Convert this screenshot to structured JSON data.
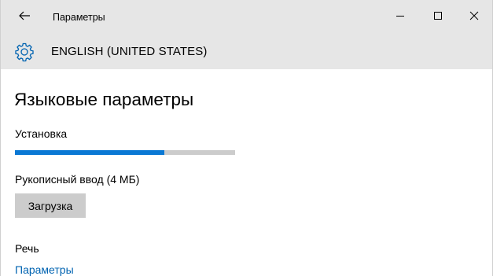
{
  "window": {
    "title": "Параметры",
    "back_icon": "back-arrow-icon",
    "minimize_icon": "minimize-icon",
    "maximize_icon": "maximize-icon",
    "close_icon": "close-icon"
  },
  "header": {
    "icon": "gear-icon",
    "title": "ENGLISH (UNITED STATES)"
  },
  "main": {
    "page_title": "Языковые параметры",
    "install": {
      "label": "Установка",
      "progress_fraction": 0.68
    },
    "handwriting": {
      "label": "Рукописный ввод (4 МБ)",
      "download_button": "Загрузка"
    },
    "speech": {
      "label": "Речь",
      "link": "Параметры"
    }
  },
  "colors": {
    "titlebar_bg": "#e6e6e6",
    "accent": "#0a78d4",
    "link": "#0063b1",
    "button_bg": "#cccccc",
    "track_bg": "#cccccc"
  }
}
